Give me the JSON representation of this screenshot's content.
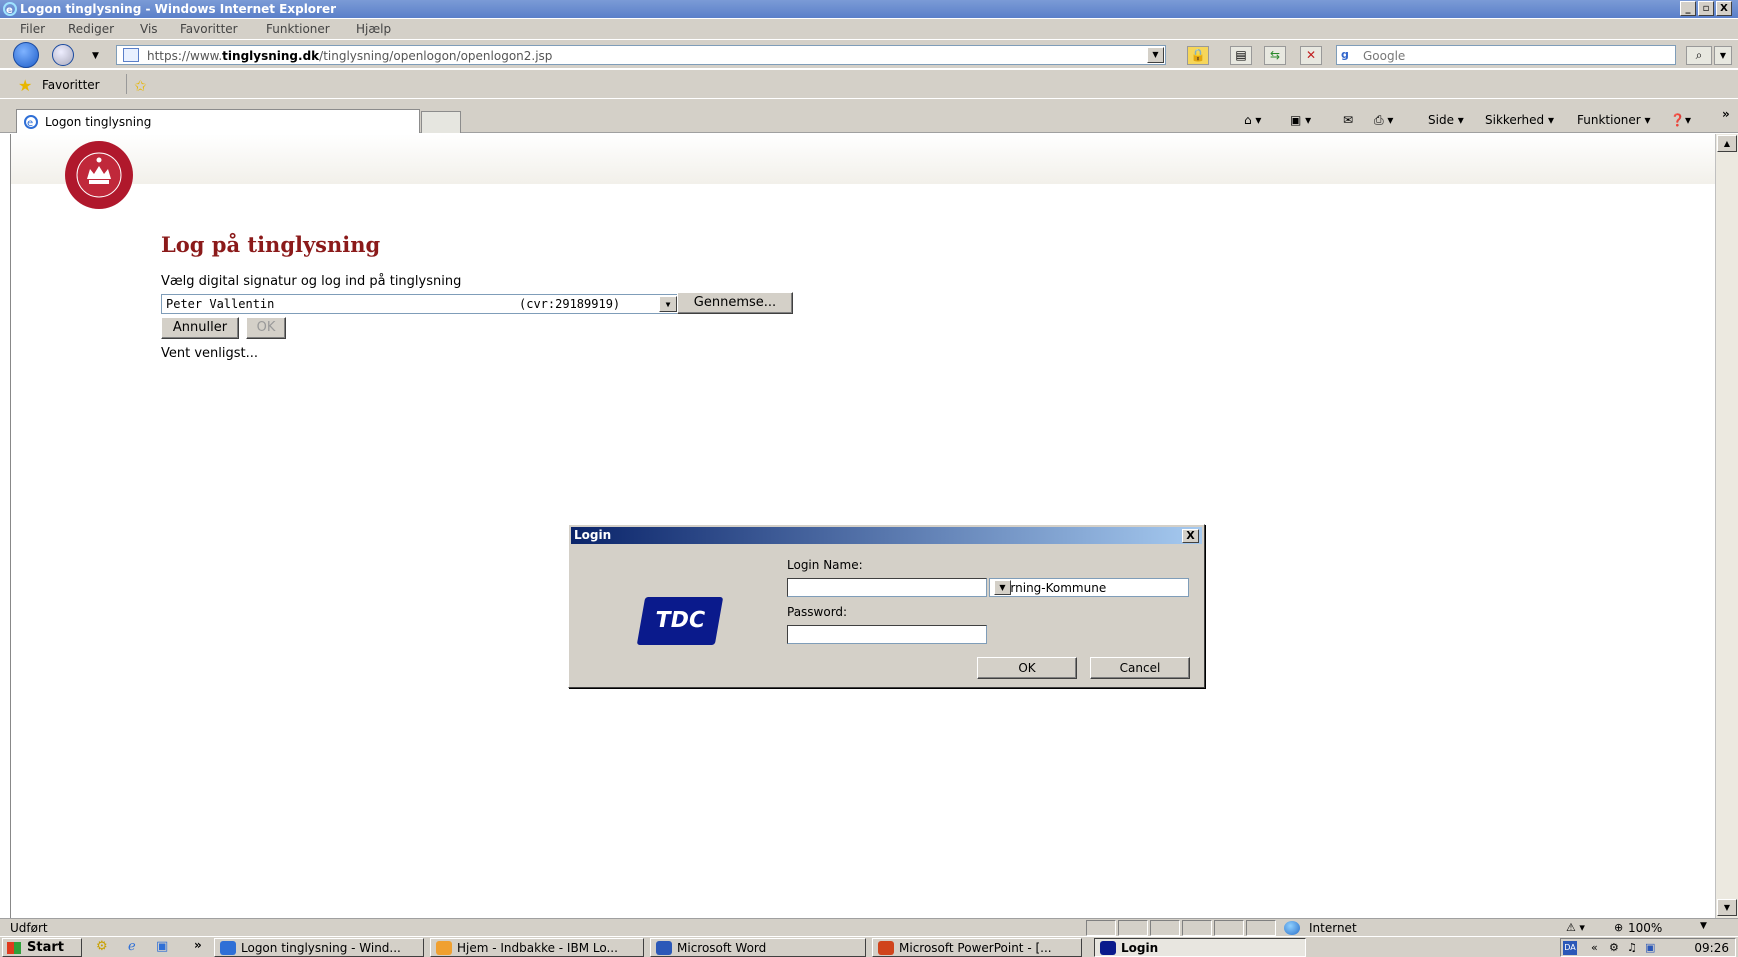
{
  "window": {
    "title": "Logon tinglysning - Windows Internet Explorer",
    "controls": [
      "_",
      "▫",
      "X"
    ]
  },
  "menu": [
    "Filer",
    "Rediger",
    "Vis",
    "Favoritter",
    "Funktioner",
    "Hjælp"
  ],
  "address": {
    "url_prefix": "https://www.",
    "url_domain": "tinglysning.dk",
    "url_path": "/tinglysning/openlogon/openlogon2.jsp"
  },
  "search": {
    "placeholder": "Google"
  },
  "favorites": {
    "label": "Favoritter"
  },
  "tabs": [
    {
      "label": "Logon tinglysning"
    }
  ],
  "command_bar": {
    "side": "Side ▾",
    "security": "Sikkerhed ▾",
    "tools": "Funktioner ▾"
  },
  "page": {
    "title": "Log på tinglysning",
    "instruction": "Vælg digital signatur og log ind på tinglysning",
    "signature_name": "Peter Vallentin",
    "signature_cvr": "(cvr:29189919)",
    "browse_label": "Gennemse...",
    "cancel_label": "Annuller",
    "ok_label": "OK",
    "wait_text": "Vent venligst..."
  },
  "dialog": {
    "title": "Login",
    "close": "X",
    "logo_text": "TDC",
    "login_name_label": "Login Name:",
    "login_name_value": "",
    "domain_value": "Herning-Kommune",
    "password_label": "Password:",
    "password_value": "",
    "ok_label": "OK",
    "cancel_label": "Cancel"
  },
  "status": {
    "text": "Udført",
    "zone": "Internet",
    "zoom": "100%"
  },
  "taskbar": {
    "start_label": "Start",
    "tasks": [
      {
        "label": "Logon tinglysning - Wind...",
        "color": "#2f6fd6"
      },
      {
        "label": "Hjem - Indbakke - IBM Lo...",
        "color": "#f0a030"
      },
      {
        "label": "Microsoft Word",
        "color": "#2b58b8"
      },
      {
        "label": "Microsoft PowerPoint - [...",
        "color": "#d0441c"
      },
      {
        "label": "Login",
        "color": "#0a1a8c"
      }
    ],
    "clock": "09:26"
  }
}
